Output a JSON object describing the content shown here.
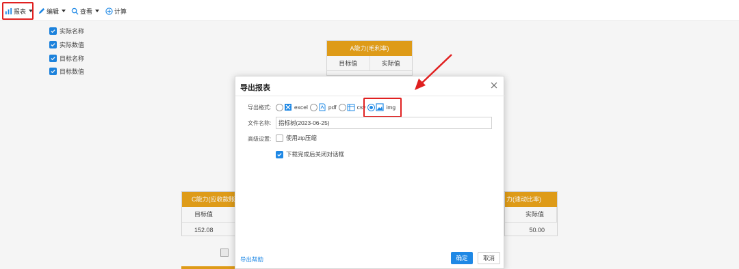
{
  "toolbar": {
    "report_label": "报表",
    "edit_label": "编辑",
    "view_label": "查看",
    "calc_label": "计算"
  },
  "checkboxes": [
    {
      "label": "实际名称",
      "checked": true
    },
    {
      "label": "实际数值",
      "checked": true
    },
    {
      "label": "目标名称",
      "checked": true
    },
    {
      "label": "目标数值",
      "checked": true
    }
  ],
  "cards": {
    "a": {
      "title": "A能力(毛利率)",
      "col1": "目标值",
      "col2": "实际值"
    },
    "c": {
      "title": "C能力(应收款账款",
      "col1": "目标值",
      "value1": "152.08"
    },
    "right": {
      "title": "力(速动比率)",
      "col2": "实际值",
      "value2": "50.00"
    }
  },
  "dialog": {
    "title": "导出报表",
    "format_label": "导出格式:",
    "formats": [
      {
        "label": "excel",
        "icon": "excel-icon",
        "selected": false
      },
      {
        "label": "pdf",
        "icon": "pdf-icon",
        "selected": false
      },
      {
        "label": "csv",
        "icon": "csv-icon",
        "selected": false
      },
      {
        "label": "img",
        "icon": "image-icon",
        "selected": true
      }
    ],
    "filename_label": "文件名称:",
    "filename_value": "指标树(2023-06-25)",
    "advanced_label": "高级设置:",
    "zip_label": "使用zip压缩",
    "close_after_label": "下载完成后关闭对话框",
    "help_link": "导出帮助",
    "ok_label": "确定",
    "cancel_label": "取消"
  },
  "colors": {
    "accent": "#1e88e5",
    "card_header": "#e8a21a",
    "highlight": "#e02020"
  }
}
